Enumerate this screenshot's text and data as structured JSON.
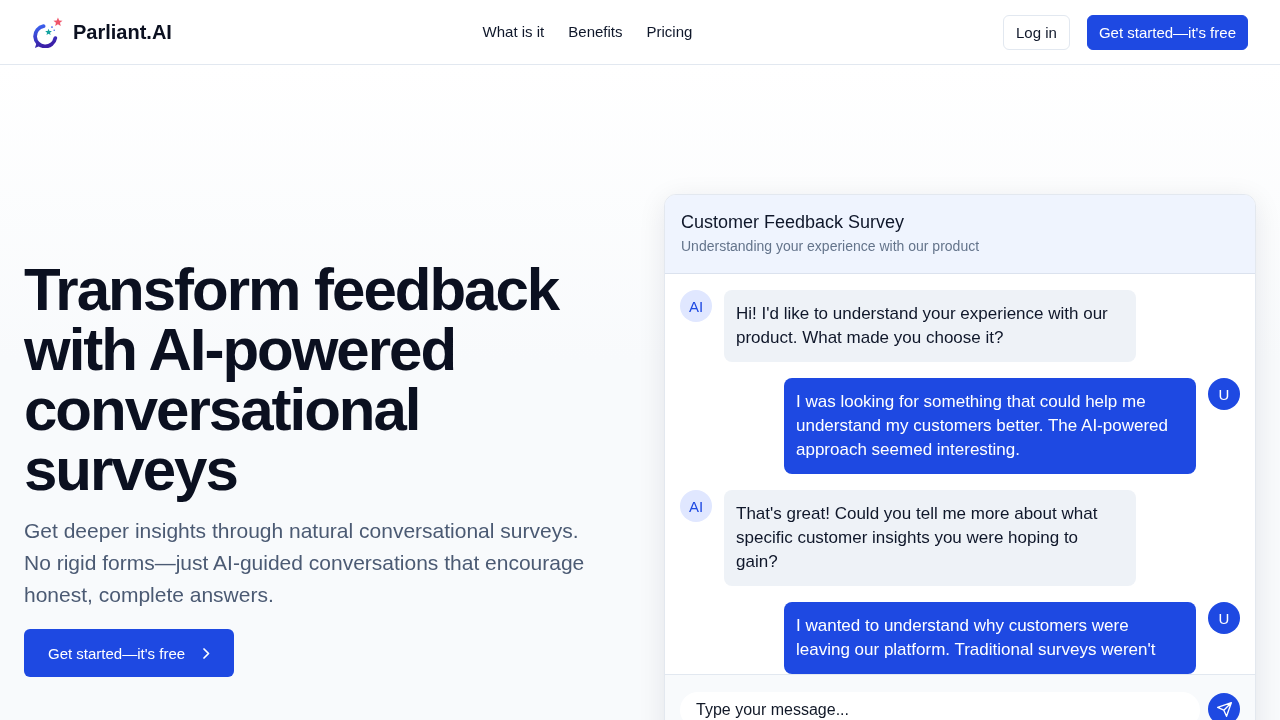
{
  "header": {
    "logo": {
      "text": "Parliant.AI"
    },
    "nav": [
      "What is it",
      "Benefits",
      "Pricing"
    ],
    "buttons": [
      {
        "label": "Log in",
        "kind": "outline"
      },
      {
        "label": "Get started—it's free",
        "kind": "primary"
      }
    ]
  },
  "hero": {
    "headline": "Transform feedback with AI-powered conversational surveys",
    "description": "Get deeper insights through natural conversational surveys. No rigid forms—just AI-guided conversations that encourage honest, complete answers.",
    "cta": {
      "label": "Get started—it's free"
    }
  },
  "chat": {
    "title": "Customer Feedback Survey",
    "subtitle": "Understanding your experience with our product",
    "messages": [
      {
        "kind": "ai",
        "avatar": "AI",
        "text": "Hi! I'd like to understand your experience with our product. What made you choose it?"
      },
      {
        "kind": "user",
        "avatar": "U",
        "text": "I was looking for something that could help me understand my customers better. The AI-powered approach seemed interesting."
      },
      {
        "kind": "ai",
        "avatar": "AI",
        "text": "That's great! Could you tell me more about what specific customer insights you were hoping to gain?"
      },
      {
        "kind": "user",
        "avatar": "U",
        "text": "I wanted to understand why customers were leaving our platform. Traditional surveys weren't"
      }
    ],
    "input": {
      "placeholder": "Type your message..."
    }
  }
}
